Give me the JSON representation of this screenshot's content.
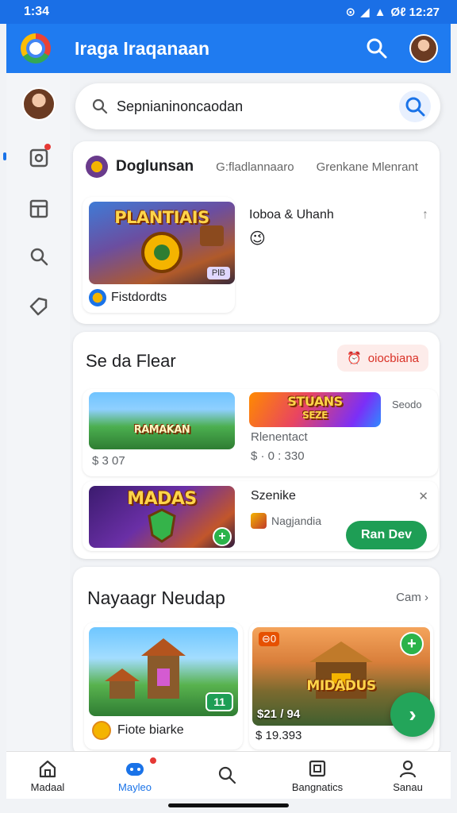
{
  "status": {
    "time": "1:34",
    "right": "Øℓ 12:27"
  },
  "app": {
    "title": "Iraga Iraqanaan",
    "brand_color": "#1f7bf0"
  },
  "search": {
    "placeholder": "Sepnianinoncaodan"
  },
  "card1": {
    "tabs": [
      "Doglunsan",
      "G:fladlannaaro",
      "Grenkane Mlenrant"
    ],
    "featured": {
      "thumb_text": "PLANTIAIS",
      "thumb_tag": "PlB",
      "app_label": "Fistdordts",
      "title": "Ioboa & Uhanh",
      "emoji": "😉"
    }
  },
  "card2": {
    "title": "Se da Flear",
    "chip": "oiocbiana",
    "items": [
      {
        "thumb_text": "RAMAKAN",
        "price": "$ 3 07"
      },
      {
        "thumb_text": "STUANS",
        "thumb_sub": "SEZE",
        "title": "Rlenentact",
        "corner": "Seodo",
        "price": "$ · 0 : 330"
      }
    ],
    "promo": {
      "thumb_text": "MADAS",
      "title": "Szenike",
      "sub": "Nagjandia",
      "button": "Ran Dev"
    }
  },
  "card3": {
    "title": "Nayaagr Neudap",
    "see_all": "Cam ›",
    "items": [
      {
        "badge": "11",
        "title": "Fiote biarke"
      },
      {
        "thumb_text": "MIDADUS",
        "corner": "⊖0",
        "title": "$21 / 94",
        "price": "$ 19.393"
      }
    ]
  },
  "nav": [
    {
      "label": "Madaal"
    },
    {
      "label": "Mayleo"
    },
    {
      "label": ""
    },
    {
      "label": "Bangnatics"
    },
    {
      "label": "Sanau"
    }
  ],
  "colors": {
    "accent": "#1a73e8",
    "green": "#1e9e55",
    "red": "#d93025"
  }
}
